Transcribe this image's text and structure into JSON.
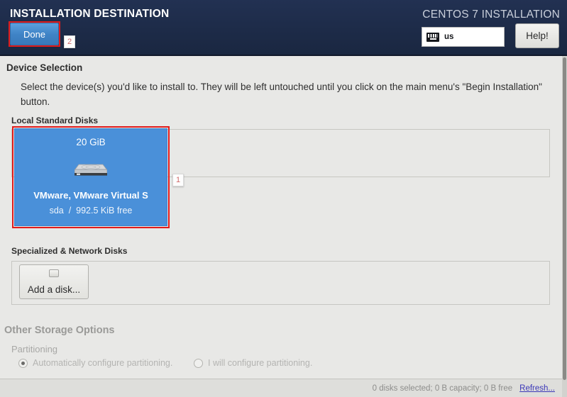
{
  "header": {
    "title": "INSTALLATION DESTINATION",
    "brand": "CENTOS 7 INSTALLATION",
    "done_label": "Done",
    "help_label": "Help!",
    "keyboard_layout": "us",
    "keyboard_icon": "keyboard-icon",
    "background_color": "#1d2b48",
    "done_color": "#3f83c6"
  },
  "annotations": [
    {
      "badge": "1",
      "target": "local-disk-tile",
      "color": "#e01b1b"
    },
    {
      "badge": "2",
      "target": "done-button",
      "color": "#e01b1b"
    }
  ],
  "main": {
    "section_title": "Device Selection",
    "description": "Select the device(s) you'd like to install to.  They will be left untouched until you click on the main menu's \"Begin Installation\" button.",
    "local_disks_label": "Local Standard Disks",
    "specialized_disks_label": "Specialized & Network Disks",
    "add_disk_label": "Add a disk...",
    "add_disk_icon": "disk-icon",
    "disks": [
      {
        "size": "20 GiB",
        "icon": "hard-drive-icon",
        "name": "VMware, VMware Virtual S",
        "device": "sda",
        "separator": "/",
        "free": "992.5 KiB free",
        "selected": true,
        "selected_color": "#4a90d9"
      }
    ]
  },
  "other_storage": {
    "title": "Other Storage Options",
    "partitioning_label": "Partitioning",
    "options": [
      {
        "label": "Automatically configure partitioning.",
        "selected": true
      },
      {
        "label": "I will configure partitioning.",
        "selected": false
      }
    ]
  },
  "status": {
    "summary": "0 disks selected; 0 B capacity; 0 B free",
    "refresh_label": "Refresh..."
  }
}
